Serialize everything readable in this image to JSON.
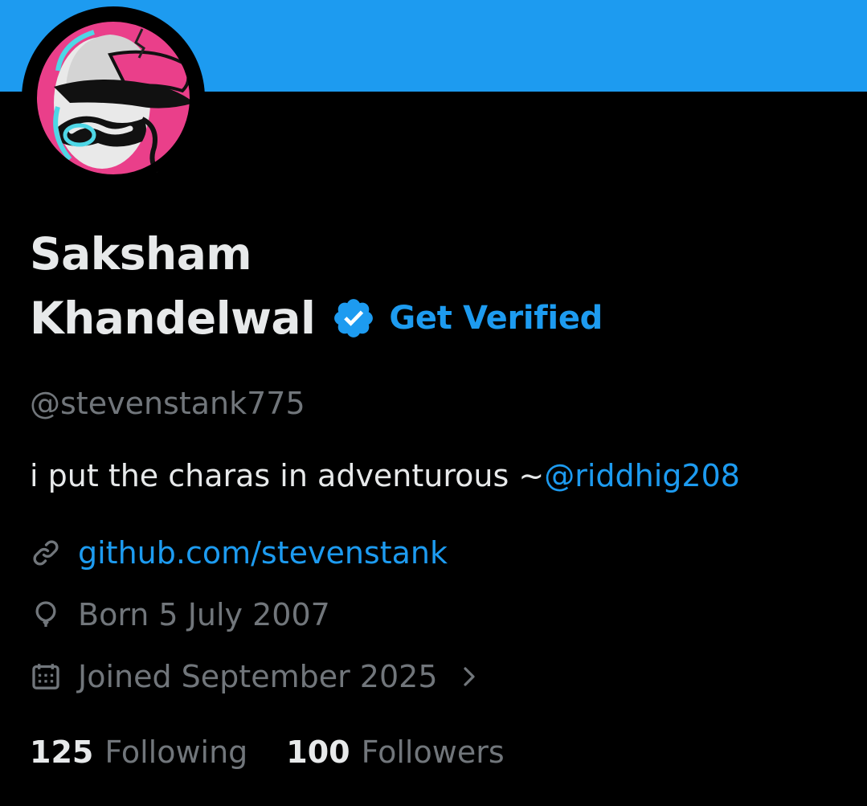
{
  "profile": {
    "name_line1": "Saksham",
    "name_line2": "Khandelwal",
    "get_verified": "Get Verified",
    "handle": "@stevenstank775",
    "bio_text": "i put the charas in adventurous ~",
    "bio_mention": "@riddhig208",
    "website": "github.com/stevenstank",
    "birthday": "Born 5 July 2007",
    "joined": "Joined September 2025",
    "following_count": "125",
    "following_label": "Following",
    "followers_count": "100",
    "followers_label": "Followers"
  },
  "icons": {
    "verified": "verified-badge-icon",
    "link": "link-icon",
    "birthday": "balloon-icon",
    "joined": "calendar-icon",
    "joined_chevron": "chevron-right-icon"
  },
  "colors": {
    "banner": "#1d9bf0",
    "background": "#000000",
    "accent": "#1d9bf0",
    "text_primary": "#e7e9ea",
    "text_secondary": "#71767b",
    "avatar_pink": "#ea3f8a",
    "avatar_cyan": "#4ed7e6"
  }
}
